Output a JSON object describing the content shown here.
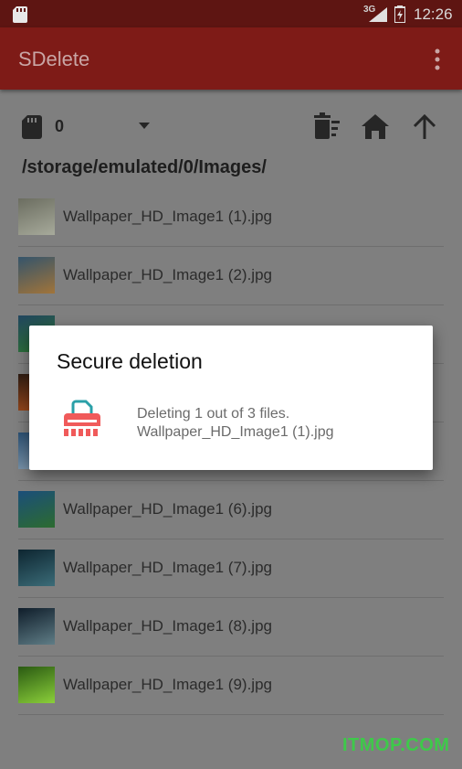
{
  "status_bar": {
    "network": "3G",
    "time": "12:26"
  },
  "app_bar": {
    "title": "SDelete"
  },
  "toolbar": {
    "storage_count": "0"
  },
  "path": "/storage/emulated/0/Images/",
  "files": [
    {
      "name": "Wallpaper_HD_Image1 (1).jpg",
      "thumb_colors": [
        "#6b6d60",
        "#a7aa9b"
      ]
    },
    {
      "name": "Wallpaper_HD_Image1 (2).jpg",
      "thumb_colors": [
        "#34546b",
        "#a1743a"
      ]
    },
    {
      "name": "",
      "thumb_colors": [
        "#21455f",
        "#2f7a32"
      ]
    },
    {
      "name": "",
      "thumb_colors": [
        "#2b1b12",
        "#b5541e"
      ]
    },
    {
      "name": "",
      "thumb_colors": [
        "#2a4f72",
        "#8fa6b9"
      ]
    },
    {
      "name": "Wallpaper_HD_Image1 (6).jpg",
      "thumb_colors": [
        "#1b4e7a",
        "#2c6b2f"
      ]
    },
    {
      "name": "Wallpaper_HD_Image1 (7).jpg",
      "thumb_colors": [
        "#0d2530",
        "#3b6c78"
      ]
    },
    {
      "name": "Wallpaper_HD_Image1 (8).jpg",
      "thumb_colors": [
        "#0f1d2a",
        "#5f7d86"
      ]
    },
    {
      "name": "Wallpaper_HD_Image1 (9).jpg",
      "thumb_colors": [
        "#2a5a12",
        "#8bcf3a"
      ]
    }
  ],
  "dialog": {
    "title": "Secure deletion",
    "progress_text": "Deleting 1 out of 3 files.",
    "current_file": "Wallpaper_HD_Image1 (1).jpg",
    "icon": "shredder-icon"
  },
  "watermark": "ITMOP.COM",
  "colors": {
    "app_bar": "#7e1b17",
    "status_bar": "#5e1512",
    "watermark": "#3ec94a",
    "shredder_body": "#f05a5a",
    "shredder_paper": "#2aa0a8"
  }
}
